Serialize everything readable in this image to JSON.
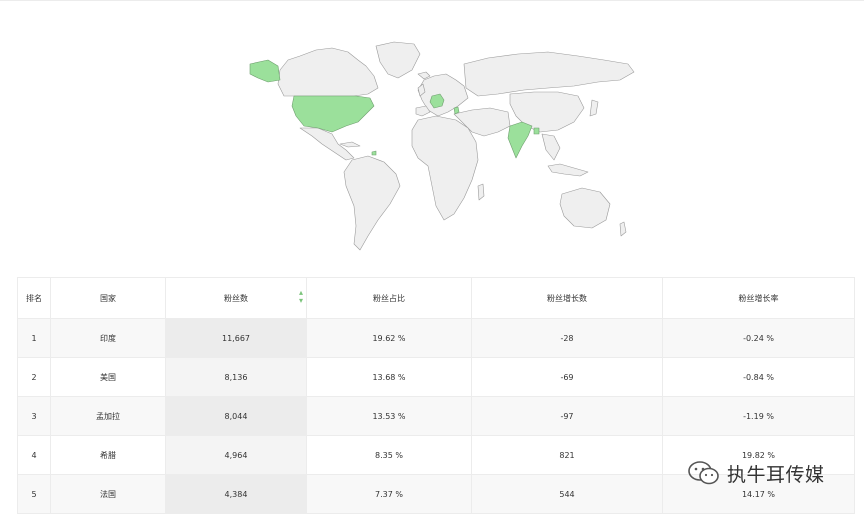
{
  "map": {
    "highlight_color": "#9be09b",
    "base_color": "#efefef",
    "border_color": "#999999",
    "highlighted_countries": [
      "印度",
      "美国",
      "孟加拉",
      "希腊",
      "法国"
    ]
  },
  "table": {
    "headers": [
      "排名",
      "国家",
      "粉丝数",
      "粉丝占比",
      "粉丝增长数",
      "粉丝增长率"
    ],
    "sorted_column": "粉丝数",
    "sort_icon": "sort-down-icon",
    "rows": [
      {
        "rank": "1",
        "country": "印度",
        "fans": "11,667",
        "share": "19.62 %",
        "growth": "-28",
        "rate": "-0.24 %"
      },
      {
        "rank": "2",
        "country": "美国",
        "fans": "8,136",
        "share": "13.68 %",
        "growth": "-69",
        "rate": "-0.84 %"
      },
      {
        "rank": "3",
        "country": "孟加拉",
        "fans": "8,044",
        "share": "13.53 %",
        "growth": "-97",
        "rate": "-1.19 %"
      },
      {
        "rank": "4",
        "country": "希腊",
        "fans": "4,964",
        "share": "8.35 %",
        "growth": "821",
        "rate": "19.82 %"
      },
      {
        "rank": "5",
        "country": "法国",
        "fans": "4,384",
        "share": "7.37 %",
        "growth": "544",
        "rate": "14.17 %"
      }
    ]
  },
  "watermark": {
    "text": "执牛耳传媒",
    "icon": "wechat-icon"
  }
}
